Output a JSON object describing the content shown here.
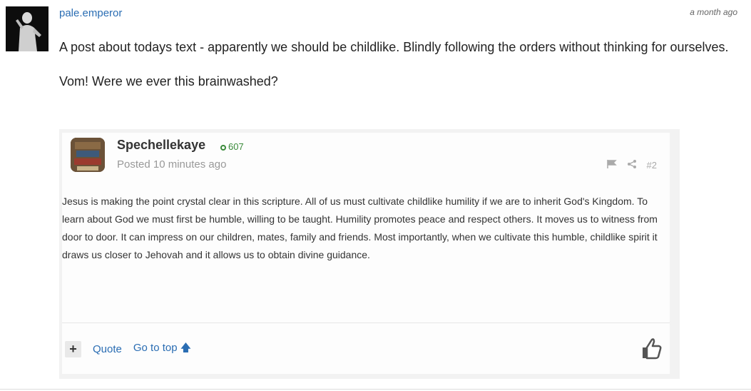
{
  "comment": {
    "username": "pale.emperor",
    "timestamp": "a month ago",
    "paragraphs": [
      "A post about todays text - apparently we should be childlike. Blindly following the orders without thinking for ourselves.",
      "Vom! Were we ever this brainwashed?"
    ]
  },
  "embedded_post": {
    "author": "Spechellekaye",
    "reputation": "607",
    "posted": "Posted 10 minutes ago",
    "post_number": "#2",
    "body": "Jesus is making the point crystal clear in this scripture. All of us must cultivate childlike humility if we are to inherit God's Kingdom. To learn about God we must first be humble, willing to be taught.   Humility promotes peace and respect others. It moves us to witness from door to door. It can impress on our children, mates, family and friends. Most importantly, when we cultivate this humble, childlike spirit it draws us closer to Jehovah and it allows us to obtain divine guidance.",
    "footer": {
      "plus": "+",
      "quote": "Quote",
      "go_to_top": "Go to top",
      "go_to_top_arrow": "🡅"
    }
  },
  "icons": {
    "avatar": "statue-avatar",
    "flag": "flag-icon",
    "share": "share-icon",
    "like": "thumbs-up-icon"
  },
  "colors": {
    "link": "#2a6db3",
    "reputation": "#3a8a3a"
  }
}
